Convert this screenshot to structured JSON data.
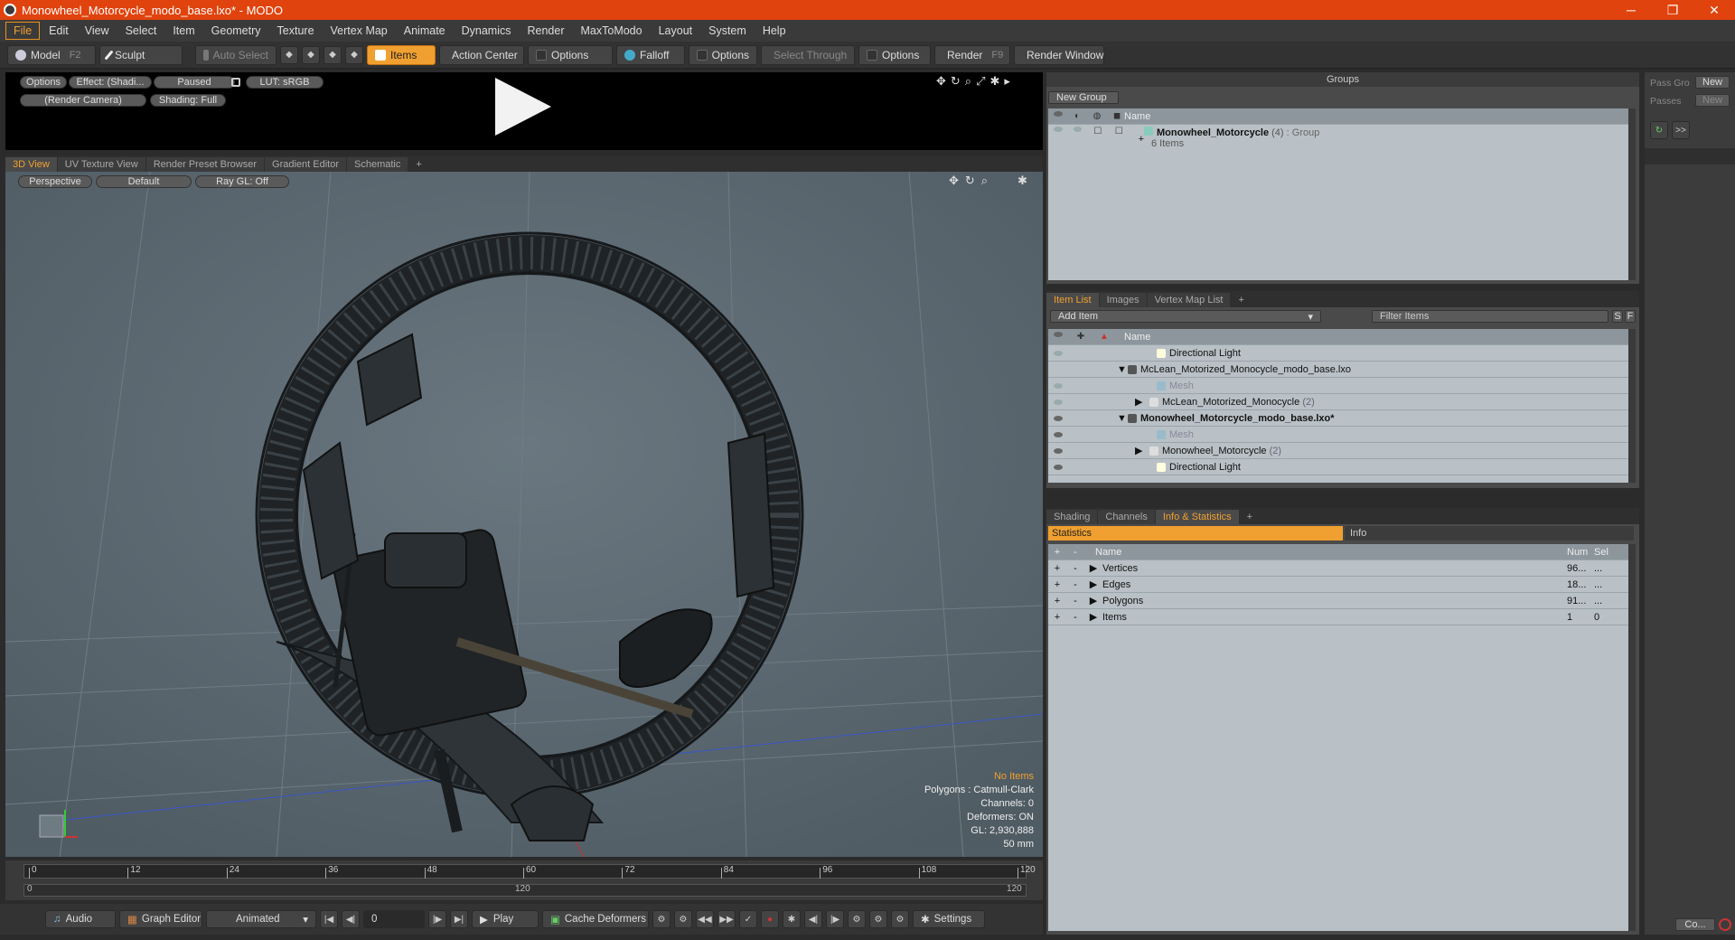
{
  "window": {
    "title": "Monowheel_Motorcycle_modo_base.lxo* - MODO",
    "minimize": "─",
    "maximize": "❐",
    "close": "✕"
  },
  "menu": [
    "File",
    "Edit",
    "View",
    "Select",
    "Item",
    "Geometry",
    "Texture",
    "Vertex Map",
    "Animate",
    "Dynamics",
    "Render",
    "MaxToModo",
    "Layout",
    "System",
    "Help"
  ],
  "toolbar": {
    "model": "Model",
    "model_key": "F2",
    "sculpt": "Sculpt",
    "auto_select": "Auto Select",
    "items": "Items",
    "action_center": "Action Center",
    "options1": "Options",
    "falloff": "Falloff",
    "options2": "Options",
    "select_through": "Select Through",
    "options3": "Options",
    "render": "Render",
    "render_key": "F9",
    "render_window": "Render Window"
  },
  "preview": {
    "options": "Options",
    "effect": "Effect: (Shadi...",
    "paused": "Paused",
    "lut": "LUT: sRGB",
    "camera": "(Render Camera)",
    "shading": "Shading: Full"
  },
  "viewport_tabs": [
    "3D View",
    "UV Texture View",
    "Render Preset Browser",
    "Gradient Editor",
    "Schematic",
    "+"
  ],
  "viewport": {
    "perspective": "Perspective",
    "default": "Default",
    "raygl": "Ray GL: Off",
    "overlay": {
      "no_items": "No Items",
      "polygons": "Polygons : Catmull-Clark",
      "channels": "Channels: 0",
      "deformers": "Deformers: ON",
      "gl": "GL: 2,930,888",
      "focal": "50 mm"
    }
  },
  "timeline": {
    "ticks": [
      "0",
      "12",
      "24",
      "36",
      "48",
      "60",
      "72",
      "84",
      "96",
      "108",
      "120"
    ],
    "range_start": "0",
    "range_mid": "120",
    "range_end": "120"
  },
  "bottom": {
    "audio": "Audio",
    "graph_editor": "Graph Editor",
    "animated": "Animated",
    "frame": "0",
    "play": "Play",
    "cache": "Cache Deformers",
    "settings": "Settings"
  },
  "groups": {
    "title": "Groups",
    "new_group": "New Group",
    "col_name": "Name",
    "item_name": "Monowheel_Motorcycle",
    "item_count": "(4)",
    "item_type": ": Group",
    "item_sub": "6 Items"
  },
  "far_right": {
    "pass_group": "Pass Gro",
    "new1": "New",
    "passes": "Passes",
    "new2": "New",
    "more": ">>",
    "co": "Co..."
  },
  "itemlist": {
    "tabs": [
      "Item List",
      "Images",
      "Vertex Map List",
      "+"
    ],
    "add_item": "Add Item",
    "filter": "Filter Items",
    "s": "S",
    "f": "F",
    "col_name": "Name",
    "rows": [
      {
        "label": "Directional Light",
        "suffix": ""
      },
      {
        "label": "McLean_Motorized_Monocycle_modo_base.lxo",
        "suffix": ""
      },
      {
        "label": "Mesh",
        "suffix": ""
      },
      {
        "label": "McLean_Motorized_Monocycle",
        "suffix": "(2)"
      },
      {
        "label": "Monowheel_Motorcycle_modo_base.lxo*",
        "suffix": ""
      },
      {
        "label": "Mesh",
        "suffix": ""
      },
      {
        "label": "Monowheel_Motorcycle",
        "suffix": "(2)"
      },
      {
        "label": "Directional Light",
        "suffix": ""
      }
    ]
  },
  "stats": {
    "tabs": [
      "Shading",
      "Channels",
      "Info & Statistics",
      "+"
    ],
    "statistics": "Statistics",
    "info": "Info",
    "col_name": "Name",
    "col_num": "Num",
    "col_sel": "Sel",
    "plus": "+",
    "minus": "-",
    "rows": [
      {
        "name": "Vertices",
        "num": "96...",
        "sel": "..."
      },
      {
        "name": "Edges",
        "num": "18...",
        "sel": "..."
      },
      {
        "name": "Polygons",
        "num": "91...",
        "sel": "..."
      },
      {
        "name": "Items",
        "num": "1",
        "sel": "0"
      }
    ]
  }
}
